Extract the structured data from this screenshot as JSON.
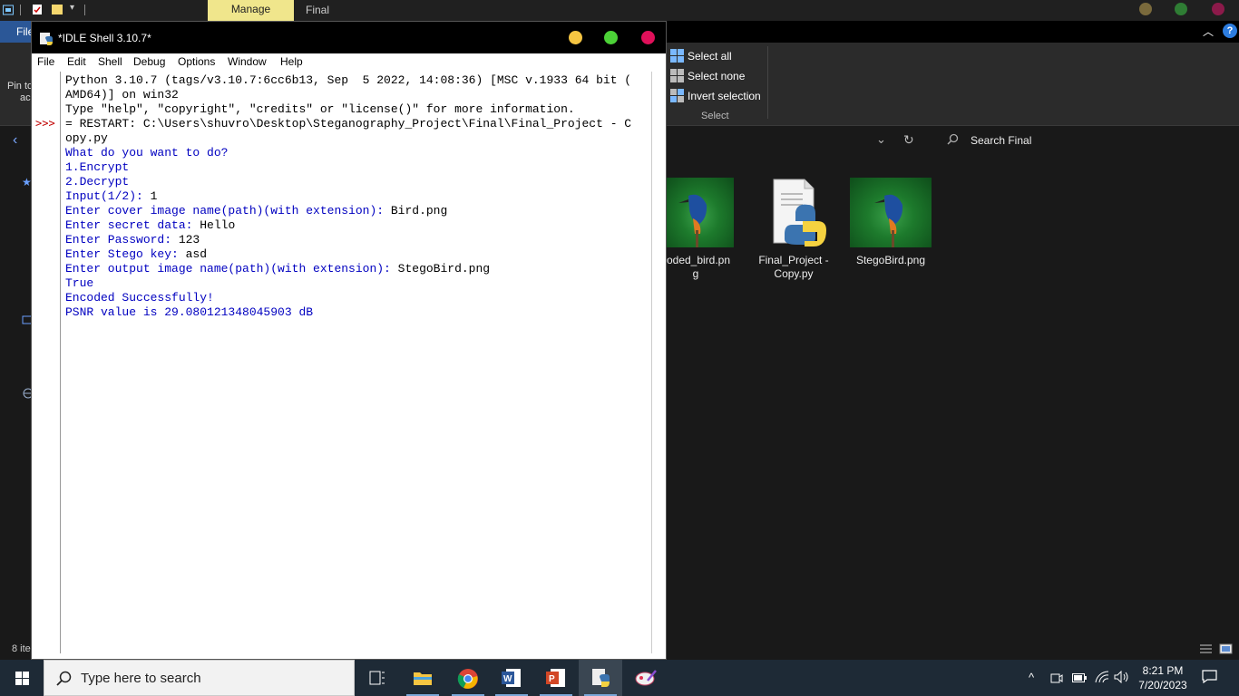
{
  "explorer": {
    "ribbon_contextual_tab": "Manage",
    "folder_title": "Final",
    "file_tab": "File",
    "select_all": "Select all",
    "select_none": "Select none",
    "invert_selection": "Invert selection",
    "select_group": "Select",
    "pin_text_1": "Pin to",
    "pin_text_2": "ac",
    "search_placeholder": "Search Final",
    "status_items": "8 ite",
    "files": [
      {
        "name_1": "coded_bird.pn",
        "name_2": "g"
      },
      {
        "name_1": "Final_Project -",
        "name_2": "Copy.py"
      },
      {
        "name_1": "StegoBird.png",
        "name_2": ""
      }
    ]
  },
  "idle": {
    "title": "*IDLE Shell 3.10.7*",
    "menu": [
      "File",
      "Edit",
      "Shell",
      "Debug",
      "Options",
      "Window",
      "Help"
    ],
    "prompt": ">>>",
    "lines": [
      "Python 3.10.7 (tags/v3.10.7:6cc6b13, Sep  5 2022, 14:08:36) [MSC v.1933 64 bit (",
      "AMD64)] on win32",
      "Type \"help\", \"copyright\", \"credits\" or \"license()\" for more information.",
      "",
      "= RESTART: C:\\Users\\shuvro\\Desktop\\Steganography_Project\\Final\\Final_Project - C",
      "opy.py",
      "What do you want to do?",
      "",
      "1.Encrypt",
      "2.Decrypt",
      "",
      "Input(1/2): ",
      "",
      "Enter cover image name(path)(with extension): ",
      "Enter secret data: ",
      "Enter Password: ",
      "Enter Stego key: ",
      "Enter output image name(path)(with extension): ",
      "True",
      "Encoded Successfully!",
      "",
      "PSNR value is 29.080121348045903 dB"
    ],
    "inputs": {
      "choice": "1",
      "cover": "Bird.png",
      "secret": "Hello",
      "password": "123",
      "stego_key": "asd",
      "output": "StegoBird.png"
    }
  },
  "taskbar": {
    "search_placeholder": "Type here to search",
    "time": "8:21 PM",
    "date": "7/20/2023"
  },
  "colors": {
    "idle_input_blue": "#0000c0",
    "prompt_red": "#c00000",
    "manage_tab": "#f0e68c",
    "mac_yellow": "#f5c542",
    "mac_green": "#4cd137",
    "mac_red": "#e0105a"
  },
  "icons": [
    "search-icon",
    "windows-logo-icon",
    "task-view-icon",
    "file-explorer-icon",
    "chrome-icon",
    "word-icon",
    "powerpoint-icon",
    "python-icon",
    "paint-icon"
  ]
}
